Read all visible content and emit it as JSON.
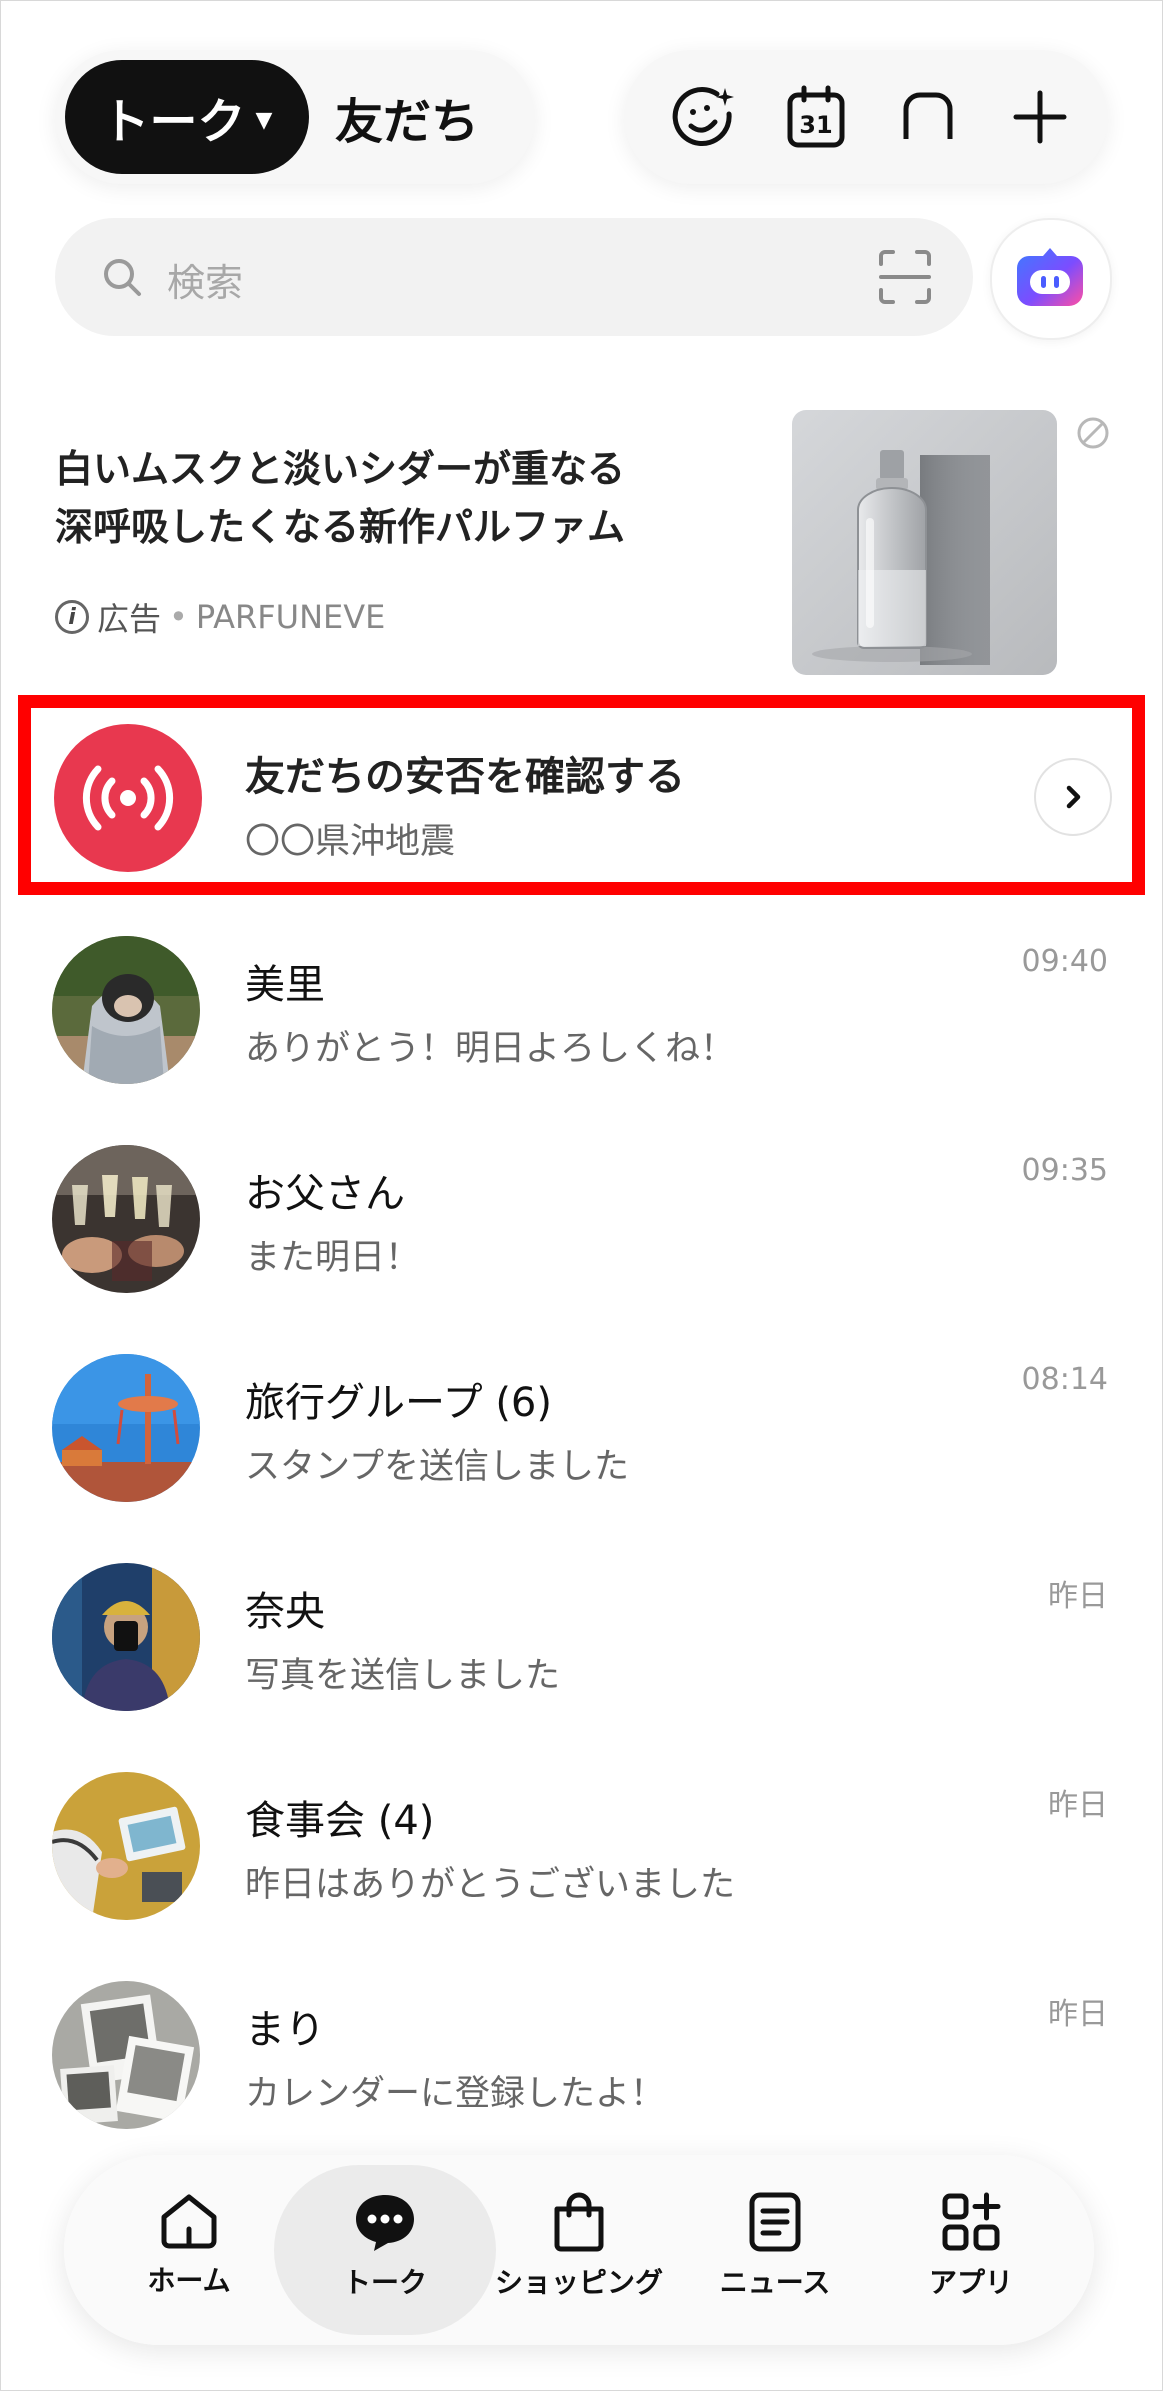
{
  "header": {
    "tab_active": "トーク",
    "tab_other": "友だち",
    "icons": [
      "sticker-sparkle-icon",
      "calendar-icon",
      "new-chat-icon",
      "add-icon"
    ],
    "calendar_day": "31"
  },
  "search": {
    "placeholder": "検索",
    "icons": [
      "search-icon",
      "scan-qr-icon",
      "ai-assistant-icon"
    ]
  },
  "ad": {
    "title_line1": "白いムスクと淡いシダーが重なる",
    "title_line2": "深呼吸したくなる新作パルファム",
    "label": "広告",
    "separator": "•",
    "brand": "PARFUNEVE",
    "info_glyph": "i"
  },
  "safety_check": {
    "title": "友だちの安否を確認する",
    "subtitle": "〇〇県沖地震",
    "icon": "broadcast-icon",
    "accent": "#e8384f",
    "highlight_color": "#ff0000"
  },
  "chats": [
    {
      "name": "美里",
      "message": "ありがとう！明日よろしくね！",
      "time": "09:40"
    },
    {
      "name": "お父さん",
      "message": "また明日！",
      "time": "09:35"
    },
    {
      "name": "旅行グループ (6)",
      "message": "スタンプを送信しました",
      "time": "08:14"
    },
    {
      "name": "奈央",
      "message": "写真を送信しました",
      "time": "昨日"
    },
    {
      "name": "食事会 (4)",
      "message": "昨日はありがとうございました",
      "time": "昨日"
    },
    {
      "name": "まり",
      "message": "カレンダーに登録したよ！",
      "time": "昨日"
    }
  ],
  "nav": {
    "items": [
      {
        "label": "ホーム",
        "icon": "home-icon"
      },
      {
        "label": "トーク",
        "icon": "chat-bubble-icon"
      },
      {
        "label": "ショッピング",
        "icon": "shopping-bag-icon"
      },
      {
        "label": "ニュース",
        "icon": "news-icon"
      },
      {
        "label": "アプリ",
        "icon": "apps-icon"
      }
    ],
    "active_index": 1
  }
}
